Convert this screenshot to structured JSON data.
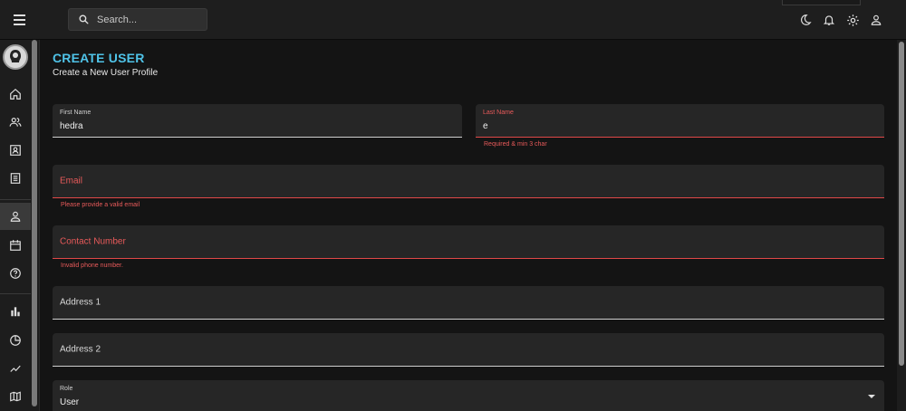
{
  "header": {
    "search": {
      "placeholder": "Search..."
    },
    "icons": [
      "menu-icon",
      "search-icon",
      "dark-mode-icon",
      "notifications-icon",
      "settings-icon",
      "person-icon"
    ]
  },
  "sidebar": {
    "items": [
      {
        "icon": "home-icon"
      },
      {
        "icon": "team-icon"
      },
      {
        "icon": "contacts-icon"
      },
      {
        "icon": "invoices-icon"
      },
      {
        "icon": "person-icon",
        "active": true
      },
      {
        "icon": "calendar-icon"
      },
      {
        "icon": "help-icon"
      },
      {
        "icon": "bar-chart-icon"
      },
      {
        "icon": "pie-chart-icon"
      },
      {
        "icon": "line-chart-icon"
      },
      {
        "icon": "map-icon"
      }
    ]
  },
  "page": {
    "title": "CREATE USER",
    "subtitle": "Create a New User Profile"
  },
  "form": {
    "first_name": {
      "label": "First Name",
      "value": "hedra"
    },
    "last_name": {
      "label": "Last Name",
      "value": "e",
      "error": "Required & min 3 char"
    },
    "email": {
      "placeholder": "Email",
      "error": "Please provide a valid email"
    },
    "contact": {
      "placeholder": "Contact Number",
      "error": "Invalid phone number."
    },
    "address1": {
      "placeholder": "Address 1"
    },
    "address2": {
      "placeholder": "Address 2"
    },
    "role": {
      "label": "Role",
      "value": "User"
    }
  },
  "colors": {
    "accent": "#4fc3e8",
    "error": "#e85a5a",
    "background": "#141414",
    "field": "#262626"
  }
}
